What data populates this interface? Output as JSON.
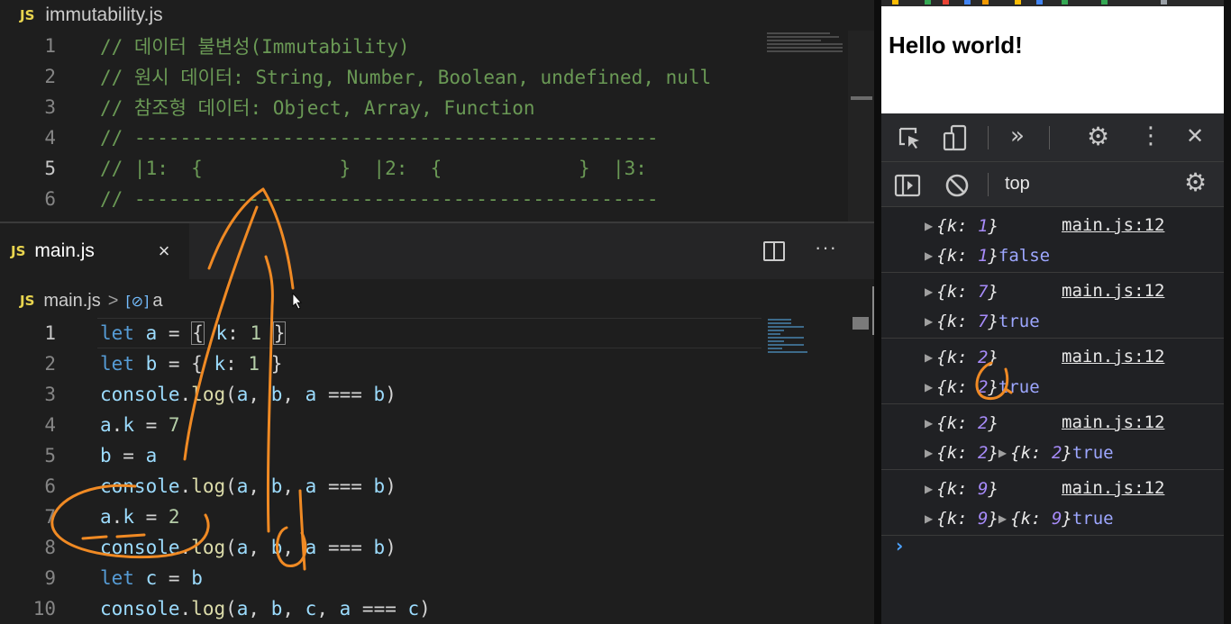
{
  "top_pane": {
    "filename": "immutability.js",
    "js_badge": "JS",
    "lines": [
      {
        "n": "1",
        "text": "// 데이터 불변성(Immutability)"
      },
      {
        "n": "2",
        "text": "// 원시 데이터: String, Number, Boolean, undefined, null"
      },
      {
        "n": "3",
        "text": "// 참조형 데이터: Object, Array, Function"
      },
      {
        "n": "4",
        "text": "// ----------------------------------------------"
      },
      {
        "n": "5",
        "text": "// |1:  {            }  |2:  {            }  |3:"
      },
      {
        "n": "6",
        "text": "// ----------------------------------------------"
      }
    ]
  },
  "editor": {
    "tab_label": "main.js",
    "js_badge": "JS",
    "close_glyph": "×",
    "more_glyph": "···",
    "breadcrumb": {
      "file": "main.js",
      "sep": ">",
      "symbol_icon": "[⊘]",
      "symbol": "a"
    },
    "lines": [
      {
        "n": "1"
      },
      {
        "n": "2"
      },
      {
        "n": "3"
      },
      {
        "n": "4"
      },
      {
        "n": "5"
      },
      {
        "n": "6"
      },
      {
        "n": "7"
      },
      {
        "n": "8"
      },
      {
        "n": "9"
      },
      {
        "n": "10"
      }
    ]
  },
  "browser": {
    "heading": "Hello world!",
    "toolbar": {
      "more": "»",
      "settings": "⚙",
      "menu": "⋮",
      "close": "✕"
    },
    "context": "top",
    "console": {
      "source": "main.js:12",
      "entries": [
        {
          "k1": "1",
          "k2": "1",
          "k3": null,
          "result": "false"
        },
        {
          "k1": "7",
          "k2": "7",
          "k3": null,
          "result": "true"
        },
        {
          "k1": "2",
          "k2": "2",
          "k3": null,
          "result": "true"
        },
        {
          "k1": "2",
          "k2": "2",
          "k3": "2",
          "result": "true"
        },
        {
          "k1": "9",
          "k2": "9",
          "k3": "9",
          "result": "true"
        }
      ],
      "prompt": "›"
    }
  },
  "colors": {
    "comment": "#6a9955",
    "keyword": "#569cd6",
    "variable": "#9cdcfe",
    "function": "#dcdcaa",
    "number": "#b5cea8",
    "annotation": "#f08a24"
  }
}
